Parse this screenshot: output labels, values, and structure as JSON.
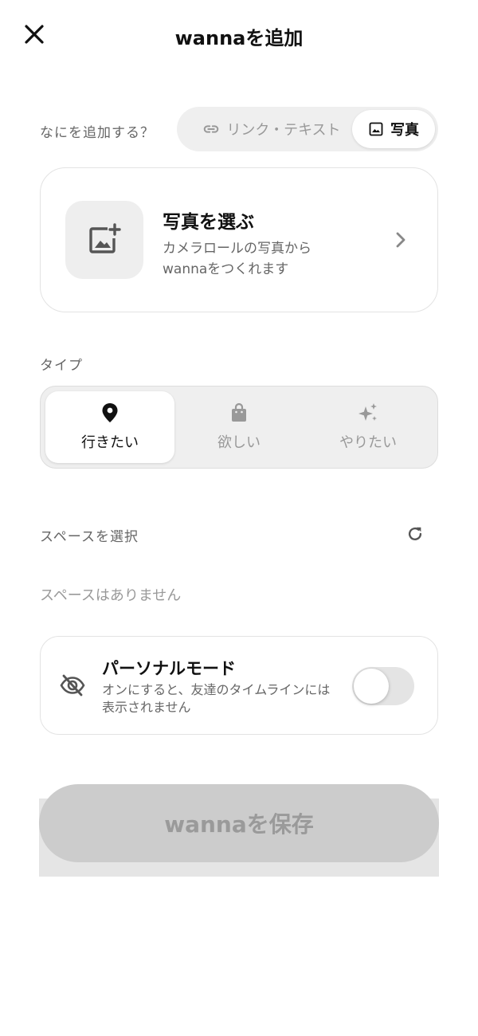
{
  "header": {
    "title": "wannaを追加"
  },
  "add_what": {
    "label": "なにを追加する？",
    "options": [
      {
        "label": "リンク・テキスト",
        "icon": "link-icon",
        "selected": false
      },
      {
        "label": "写真",
        "icon": "image-icon",
        "selected": true
      }
    ]
  },
  "photo_picker": {
    "title": "写真を選ぶ",
    "description": "カメラロールの写真からwannaをつくれます",
    "icon": "add-photo-icon"
  },
  "type": {
    "label": "タイプ",
    "options": [
      {
        "label": "行きたい",
        "icon": "location-pin-icon",
        "selected": true
      },
      {
        "label": "欲しい",
        "icon": "shopping-bag-icon",
        "selected": false
      },
      {
        "label": "やりたい",
        "icon": "sparkle-icon",
        "selected": false
      }
    ]
  },
  "space": {
    "label": "スペースを選択",
    "empty_text": "スペースはありません"
  },
  "personal_mode": {
    "title": "パーソナルモード",
    "description": "オンにすると、友達のタイムラインには表示されません",
    "enabled": false
  },
  "save_button": {
    "label": "wannaを保存",
    "disabled": true
  },
  "colors": {
    "text": "#111111",
    "muted": "#666666",
    "disabled": "#999999",
    "segment_bg": "#efefef",
    "button_disabled": "#cccccc"
  }
}
